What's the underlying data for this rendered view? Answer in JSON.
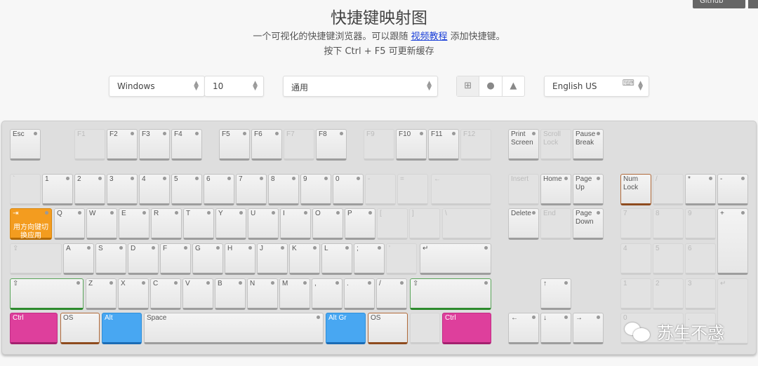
{
  "header": {
    "title": "快捷键映射图",
    "subtitle_before": "一个可视化的快捷键浏览器。可以跟随 ",
    "subtitle_link": "视频教程",
    "subtitle_after": " 添加快捷键。",
    "hint": "按下 Ctrl + F5 可更新缓存",
    "github_label": "Github"
  },
  "controls": {
    "os": "Windows",
    "version": "10",
    "app": "通用",
    "os_buttons": [
      "windows-icon",
      "apple-icon",
      "linux-icon"
    ],
    "layout": "English US"
  },
  "colors": {
    "shortcut": "#f39c1f",
    "ctrl": "#de3f9c",
    "alt": "#48a7f2",
    "os": "#b06a3a",
    "shift": "#2d8a2d"
  },
  "keys": [
    {
      "l": "Esc",
      "s": "on"
    },
    {
      "l": "F1",
      "s": "off"
    },
    {
      "l": "F2",
      "s": "on"
    },
    {
      "l": "F3",
      "s": "on"
    },
    {
      "l": "F4",
      "s": "on"
    },
    {
      "l": "F5",
      "s": "on"
    },
    {
      "l": "F6",
      "s": "on"
    },
    {
      "l": "F7",
      "s": "off"
    },
    {
      "l": "F8",
      "s": "on"
    },
    {
      "l": "F9",
      "s": "off"
    },
    {
      "l": "F10",
      "s": "on"
    },
    {
      "l": "F11",
      "s": "on"
    },
    {
      "l": "F12",
      "s": "off"
    },
    {
      "l": "Print\nScreen",
      "s": "on"
    },
    {
      "l": "Scroll\nLock",
      "s": "off"
    },
    {
      "l": "Pause\nBreak",
      "s": "on"
    },
    {
      "l": "`",
      "s": "off"
    },
    {
      "l": "1",
      "s": "on"
    },
    {
      "l": "2",
      "s": "on"
    },
    {
      "l": "3",
      "s": "on"
    },
    {
      "l": "4",
      "s": "on"
    },
    {
      "l": "5",
      "s": "on"
    },
    {
      "l": "6",
      "s": "on"
    },
    {
      "l": "7",
      "s": "on"
    },
    {
      "l": "8",
      "s": "on"
    },
    {
      "l": "9",
      "s": "on"
    },
    {
      "l": "0",
      "s": "on"
    },
    {
      "l": "-",
      "s": "off"
    },
    {
      "l": "=",
      "s": "off"
    },
    {
      "l": "←",
      "s": "off"
    },
    {
      "l": "Insert",
      "s": "off"
    },
    {
      "l": "Home",
      "s": "on"
    },
    {
      "l": "Page Up",
      "s": "on"
    },
    {
      "l": "Num\nLock",
      "s": "brown"
    },
    {
      "l": "/",
      "s": "off"
    },
    {
      "l": "*",
      "s": "on"
    },
    {
      "l": "-",
      "s": "on"
    },
    {
      "l": "⇥",
      "s": "orange",
      "note": "用方向键切换应用"
    },
    {
      "l": "Q",
      "s": "on"
    },
    {
      "l": "W",
      "s": "on"
    },
    {
      "l": "E",
      "s": "on"
    },
    {
      "l": "R",
      "s": "on"
    },
    {
      "l": "T",
      "s": "on"
    },
    {
      "l": "Y",
      "s": "on"
    },
    {
      "l": "U",
      "s": "on"
    },
    {
      "l": "I",
      "s": "on"
    },
    {
      "l": "O",
      "s": "on"
    },
    {
      "l": "P",
      "s": "on"
    },
    {
      "l": "[",
      "s": "off"
    },
    {
      "l": "]",
      "s": "off"
    },
    {
      "l": "\\",
      "s": "off"
    },
    {
      "l": "Delete",
      "s": "on"
    },
    {
      "l": "End",
      "s": "off"
    },
    {
      "l": "Page\nDown",
      "s": "on"
    },
    {
      "l": "7",
      "s": "off"
    },
    {
      "l": "8",
      "s": "off"
    },
    {
      "l": "9",
      "s": "off"
    },
    {
      "l": "+",
      "s": "on"
    },
    {
      "l": "⇪",
      "s": "off"
    },
    {
      "l": "A",
      "s": "on"
    },
    {
      "l": "S",
      "s": "on"
    },
    {
      "l": "D",
      "s": "on"
    },
    {
      "l": "F",
      "s": "on"
    },
    {
      "l": "G",
      "s": "on"
    },
    {
      "l": "H",
      "s": "on"
    },
    {
      "l": "J",
      "s": "on"
    },
    {
      "l": "K",
      "s": "on"
    },
    {
      "l": "L",
      "s": "on"
    },
    {
      "l": ";",
      "s": "on"
    },
    {
      "l": "'",
      "s": "off"
    },
    {
      "l": "↵",
      "s": "on"
    },
    {
      "l": "4",
      "s": "off"
    },
    {
      "l": "5",
      "s": "off"
    },
    {
      "l": "6",
      "s": "off"
    },
    {
      "l": "⇧",
      "s": "green"
    },
    {
      "l": "Z",
      "s": "on"
    },
    {
      "l": "X",
      "s": "on"
    },
    {
      "l": "C",
      "s": "on"
    },
    {
      "l": "V",
      "s": "on"
    },
    {
      "l": "B",
      "s": "on"
    },
    {
      "l": "N",
      "s": "on"
    },
    {
      "l": "M",
      "s": "on"
    },
    {
      "l": ",",
      "s": "on"
    },
    {
      "l": ".",
      "s": "on"
    },
    {
      "l": "/",
      "s": "on"
    },
    {
      "l": "⇧",
      "s": "green"
    },
    {
      "l": "↑",
      "s": "on"
    },
    {
      "l": "1",
      "s": "off"
    },
    {
      "l": "2",
      "s": "off"
    },
    {
      "l": "3",
      "s": "off"
    },
    {
      "l": "↵",
      "s": "off"
    },
    {
      "l": "Ctrl",
      "s": "pink"
    },
    {
      "l": "OS",
      "s": "brown"
    },
    {
      "l": "Alt",
      "s": "blue"
    },
    {
      "l": "Space",
      "s": "on"
    },
    {
      "l": "Alt Gr",
      "s": "blue"
    },
    {
      "l": "OS",
      "s": "brown"
    },
    {
      "l": "",
      "s": "off"
    },
    {
      "l": "Ctrl",
      "s": "pink"
    },
    {
      "l": "←",
      "s": "on"
    },
    {
      "l": "↓",
      "s": "on"
    },
    {
      "l": "→",
      "s": "on"
    },
    {
      "l": "0",
      "s": "off"
    },
    {
      "l": ".",
      "s": "off"
    }
  ],
  "watermark": "苏生不惑"
}
